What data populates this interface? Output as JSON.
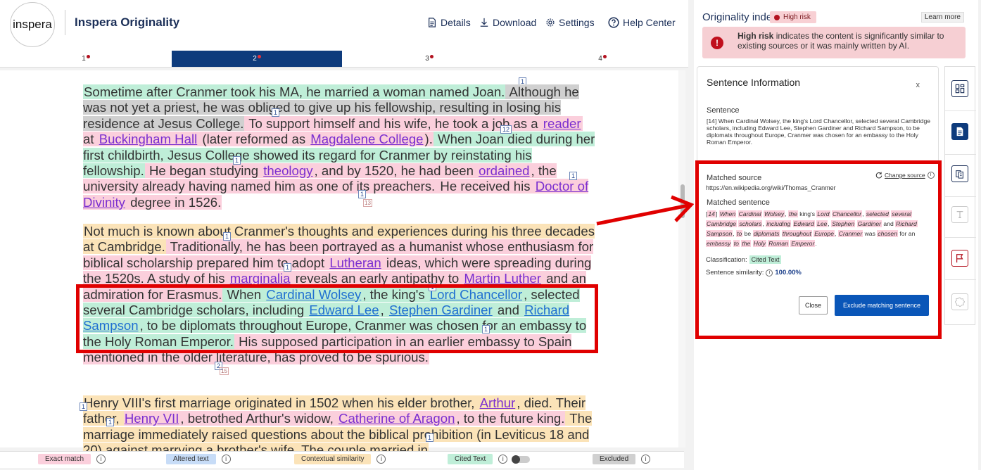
{
  "header": {
    "logo_text": "inspera",
    "app_title": "Inspera Originality",
    "nav": {
      "details": "Details",
      "download": "Download",
      "settings": "Settings",
      "help": "Help Center"
    }
  },
  "tabs": [
    {
      "label": "1",
      "active": false
    },
    {
      "label": "2",
      "active": true
    },
    {
      "label": "3",
      "active": false
    },
    {
      "label": "4",
      "active": false
    }
  ],
  "document": {
    "p1": [
      {
        "t": "Sometime after Cranmer took his MA, he married a woman named Joan.",
        "c": "ct"
      },
      {
        "t": " Although he was not yet a priest, he was obliged to give up his fellowship, resulting in losing his residence at Jesus College.",
        "c": "gr"
      },
      {
        "t": " To support himself and his wife, he took a job as a ",
        "c": "ex"
      },
      {
        "t": "reader",
        "c": "ex",
        "link": true
      },
      {
        "t": " at ",
        "c": "ex"
      },
      {
        "t": "Buckingham Hall",
        "c": "ex",
        "link": true
      },
      {
        "t": " (later reformed as ",
        "c": "ex"
      },
      {
        "t": "Magdalene College",
        "c": "ex",
        "link": true
      },
      {
        "t": ").",
        "c": "ex"
      },
      {
        "t": " When Joan died during her first childbirth, Jesus College showed its regard for Cranmer by reinstating his fellowship.",
        "c": "ct"
      },
      {
        "t": " He began studying ",
        "c": "ex"
      },
      {
        "t": "theology",
        "c": "ex",
        "link": true
      },
      {
        "t": ", and by 1520, he had been ",
        "c": "ex"
      },
      {
        "t": "ordained",
        "c": "ex",
        "link": true
      },
      {
        "t": ", the university already having named him as one of its preachers.",
        "c": "ex"
      },
      {
        "t": " He received his ",
        "c": "ex"
      },
      {
        "t": "Doctor of Divinity",
        "c": "ex",
        "link": true
      },
      {
        "t": " degree in 1526.",
        "c": "ex"
      }
    ],
    "p2": [
      {
        "t": "Not much is known about Cranmer's thoughts and experiences during his three decades at Cambridge.",
        "c": "cx"
      },
      {
        "t": " Traditionally, he has been portrayed as a humanist whose enthusiasm for biblical scholarship prepared him to adopt ",
        "c": "ex"
      },
      {
        "t": "Lutheran",
        "c": "ex",
        "link": true
      },
      {
        "t": " ideas, which were spreading during the 1520s. A study of his ",
        "c": "ex"
      },
      {
        "t": "marginalia",
        "c": "ex",
        "link": true
      },
      {
        "t": " reveals an early antipathy to ",
        "c": "ex"
      },
      {
        "t": "Martin Luther",
        "c": "ex",
        "link": true
      },
      {
        "t": " and an admiration for Erasmus.",
        "c": "ex"
      },
      {
        "t": " When ",
        "c": "ct"
      },
      {
        "t": "Cardinal Wolsey",
        "c": "ct",
        "linkb": true
      },
      {
        "t": ", the king's ",
        "c": "ct"
      },
      {
        "t": "Lord Chancellor",
        "c": "ct",
        "linkb": true
      },
      {
        "t": ", selected several Cambridge scholars, including ",
        "c": "ct"
      },
      {
        "t": "Edward Lee",
        "c": "ct",
        "linkb": true
      },
      {
        "t": ", ",
        "c": "ct"
      },
      {
        "t": "Stephen Gardiner",
        "c": "ct",
        "linkb": true
      },
      {
        "t": " and ",
        "c": "ct"
      },
      {
        "t": "Richard Sampson",
        "c": "ct",
        "linkb": true
      },
      {
        "t": ", to be diplomats throughout Europe, Cranmer was chosen for an embassy to the Holy Roman Emperor.",
        "c": "ct"
      },
      {
        "t": " His supposed participation in an earlier embassy to Spain mentioned in the older literature, has proved to be spurious.",
        "c": "ex"
      }
    ],
    "p3": [
      {
        "t": "Henry VIII's first marriage originated in 1502 when his elder brother, ",
        "c": "cx"
      },
      {
        "t": "Arthur",
        "c": "cx",
        "link": true
      },
      {
        "t": ", died. Their father, ",
        "c": "cx"
      },
      {
        "t": "Henry VII",
        "c": "ex",
        "link": true
      },
      {
        "t": ", betrothed Arthur's widow, ",
        "c": "ex"
      },
      {
        "t": "Catherine of Aragon",
        "c": "ex",
        "link": true
      },
      {
        "t": ", to the future king.",
        "c": "ex"
      },
      {
        "t": " The marriage immediately raised questions about the biblical prohibition (in Leviticus 18 and 20) against marrying a brother's wife. The couple married in",
        "c": "cx"
      }
    ]
  },
  "legend": {
    "exact": "Exact match",
    "altered": "Altered text",
    "contextual": "Contextual similarity",
    "cited": "Cited Text",
    "excluded": "Excluded"
  },
  "originality": {
    "title": "Originality index",
    "risk_badge": "High risk",
    "learn_more": "Learn more",
    "alert_bold": "High risk",
    "alert_text": " indicates the content is significantly similar to existing sources or it was mainly written by AI."
  },
  "sentence_info": {
    "title": "Sentence Information",
    "close_x": "x",
    "sentence_label": "Sentence",
    "sentence_text": "[14] When Cardinal Wolsey, the king's Lord Chancellor, selected several Cambridge scholars, including Edward Lee, Stephen Gardiner and Richard Sampson, to be diplomats throughout Europe, Cranmer was chosen for an embassy to the Holy Roman Emperor.",
    "matched_source_label": "Matched source",
    "change_source": "Change source",
    "source_url": "https://en.wikipedia.org/wiki/Thomas_Cranmer",
    "matched_sentence_label": "Matched sentence",
    "matched_words": [
      {
        "t": "[",
        "h": false
      },
      {
        "t": "14",
        "h": true
      },
      {
        "t": "] ",
        "h": false
      },
      {
        "t": "When",
        "h": true
      },
      {
        "t": " ",
        "h": false
      },
      {
        "t": "Cardinal",
        "h": true
      },
      {
        "t": " ",
        "h": false
      },
      {
        "t": "Wolsey",
        "h": true
      },
      {
        "t": ", ",
        "h": false
      },
      {
        "t": "the",
        "h": true
      },
      {
        "t": " king's ",
        "h": false
      },
      {
        "t": "Lord",
        "h": true
      },
      {
        "t": " ",
        "h": false
      },
      {
        "t": "Chancellor",
        "h": true
      },
      {
        "t": ", ",
        "h": false
      },
      {
        "t": "selected",
        "h": true
      },
      {
        "t": " ",
        "h": false
      },
      {
        "t": "several",
        "h": true
      },
      {
        "t": " ",
        "h": false
      },
      {
        "t": "Cambridge",
        "h": true
      },
      {
        "t": " ",
        "h": false
      },
      {
        "t": "scholars",
        "h": true
      },
      {
        "t": ", ",
        "h": false
      },
      {
        "t": "including",
        "h": true
      },
      {
        "t": " ",
        "h": false
      },
      {
        "t": "Edward",
        "h": true
      },
      {
        "t": " ",
        "h": false
      },
      {
        "t": "Lee",
        "h": true
      },
      {
        "t": ", ",
        "h": false
      },
      {
        "t": "Stephen",
        "h": true
      },
      {
        "t": " ",
        "h": false
      },
      {
        "t": "Gardiner",
        "h": true
      },
      {
        "t": " and ",
        "h": false
      },
      {
        "t": "Richard",
        "h": true
      },
      {
        "t": " ",
        "h": false
      },
      {
        "t": "Sampson",
        "h": true
      },
      {
        "t": ", ",
        "h": false
      },
      {
        "t": "to",
        "h": true
      },
      {
        "t": " be ",
        "h": false
      },
      {
        "t": "diplomats",
        "h": true
      },
      {
        "t": " ",
        "h": false
      },
      {
        "t": "throughout",
        "h": true
      },
      {
        "t": " ",
        "h": false
      },
      {
        "t": "Europe",
        "h": true
      },
      {
        "t": ", ",
        "h": false
      },
      {
        "t": "Cranmer",
        "h": true
      },
      {
        "t": " was ",
        "h": false
      },
      {
        "t": "chosen",
        "h": true
      },
      {
        "t": " for an ",
        "h": false
      },
      {
        "t": "embassy",
        "h": true
      },
      {
        "t": " ",
        "h": false
      },
      {
        "t": "to",
        "h": true
      },
      {
        "t": " ",
        "h": false
      },
      {
        "t": "the",
        "h": true
      },
      {
        "t": " ",
        "h": false
      },
      {
        "t": "Holy",
        "h": true
      },
      {
        "t": " ",
        "h": false
      },
      {
        "t": "Roman",
        "h": true
      },
      {
        "t": " ",
        "h": false
      },
      {
        "t": "Emperor",
        "h": true
      },
      {
        "t": ".",
        "h": false
      }
    ],
    "classification_label": "Classification:",
    "classification_value": "Cited Text",
    "similarity_label": "Sentence similarity:",
    "similarity_value": "100.00%",
    "close_button": "Close",
    "exclude_button": "Exclude matching sentence"
  },
  "markers": {
    "one": "1",
    "two": "2",
    "m12": "12",
    "m13": "13",
    "m15": "15"
  },
  "colors": {
    "exact": "#fbcfdc",
    "cited": "#bfeed8",
    "contextual": "#fbe3b8",
    "altered": "#c7dcf7",
    "excluded": "#d0d0d0",
    "brand": "#0e3b7c",
    "risk": "#b3121f"
  }
}
